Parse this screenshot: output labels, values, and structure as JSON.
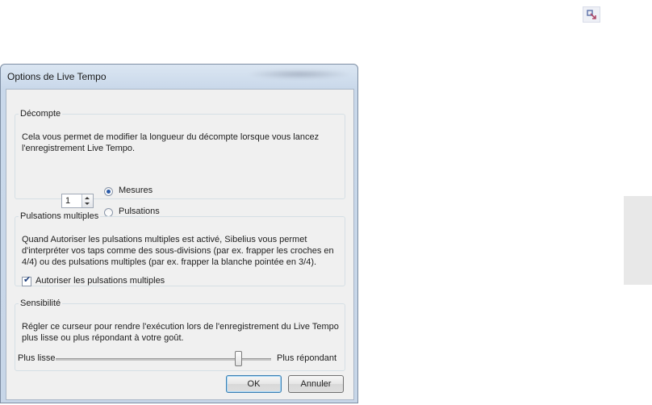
{
  "dialog": {
    "title": "Options de Live Tempo"
  },
  "countin": {
    "legend": "Décompte",
    "description": "Cela vous permet de modifier la longueur du décompte lorsque vous lancez l'enregistrement Live Tempo.",
    "spin_value": "1",
    "radio_bars": "Mesures",
    "radio_beats": "Pulsations",
    "selected": "Mesures"
  },
  "multiple": {
    "legend": "Pulsations multiples",
    "description": "Quand Autoriser les pulsations multiples est activé, Sibelius vous permet d'interpréter vos taps comme des sous-divisions (par ex. frapper les croches en 4/4) ou des pulsations multiples (par ex. frapper la blanche pointée en 3/4).",
    "checkbox_label": "Autoriser les pulsations multiples",
    "checked": true
  },
  "sensitivity": {
    "legend": "Sensibilité",
    "description": "Régler ce curseur pour rendre l'exécution lors de l'enregistrement du Live Tempo plus lisse ou plus répondant à votre goût.",
    "left_label": "Plus lisse",
    "right_label": "Plus répondant",
    "slider_value": 0.85
  },
  "buttons": {
    "ok": "OK",
    "cancel": "Annuler"
  }
}
